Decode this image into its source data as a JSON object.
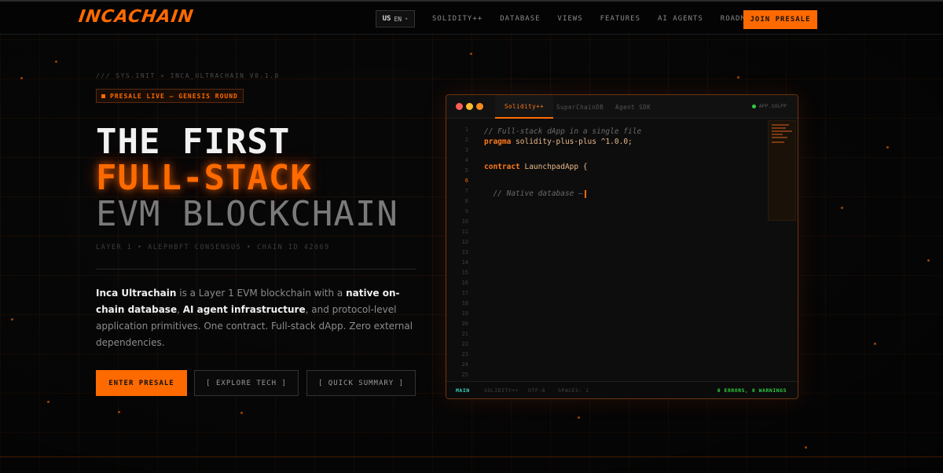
{
  "nav": {
    "logo": "INCACHAIN",
    "lang": {
      "flag": "US",
      "code": "EN",
      "chevron": "▾"
    },
    "links": [
      "SOLIDITY++",
      "DATABASE",
      "VIEWS",
      "FEATURES",
      "AI AGENTS",
      "ROADMAP"
    ],
    "cta": "JOIN PRESALE"
  },
  "hero": {
    "sysinit": "/// SYS.INIT » INCA_ULTRACHAIN V0.1.0",
    "badge": "PRESALE LIVE — GENESIS ROUND",
    "title_line1": "THE FIRST",
    "title_line2": "FULL-STACK",
    "title_line3": "EVM BLOCKCHAIN",
    "meta": "LAYER 1 • ALEPHBFT CONSENSUS • CHAIN ID 42069",
    "desc": {
      "p1": "Inca Ultrachain",
      "p2": " is a Layer 1 EVM blockchain with a ",
      "p3": "native on-chain database",
      "p4": ", ",
      "p5": "AI agent infrastructure",
      "p6": ", and protocol-level application primitives. One contract. Full-stack dApp. Zero external dependencies."
    },
    "buttons": {
      "primary": "ENTER PRESALE",
      "explore": "[ EXPLORE TECH ]",
      "summary": "[ QUICK SUMMARY ]"
    }
  },
  "editor": {
    "tabs": [
      "Solidity++",
      "SuperChainDB",
      "Agent SDK"
    ],
    "file": "APP.SOLPP",
    "line_numbers": [
      "1",
      "2",
      "3",
      "4",
      "5",
      "6",
      "7",
      "8",
      "9",
      "10",
      "11",
      "12",
      "13",
      "14",
      "15",
      "16",
      "17",
      "18",
      "19",
      "20",
      "21",
      "22",
      "23",
      "24",
      "25"
    ],
    "current_line": "6",
    "code": {
      "l1": "// Full-stack dApp in a single file",
      "l2_kw": "pragma",
      "l2_id": " solidity-plus-plus",
      "l2_ver": " ^1.0.0;",
      "l4_kw": "contract",
      "l4_id": " LaunchpadApp",
      "l4_rest": " {",
      "l7": "  // Native database —"
    },
    "statusbar": {
      "branch": "MAIN",
      "lang": "SOLIDITY++",
      "encoding": "UTF-8",
      "spaces": "SPACES: 2",
      "result": "0 ERRORS, 0 WARNINGS"
    }
  },
  "colors": {
    "accent": "#ff6a00",
    "bg": "#070707",
    "ok": "#2ecc40"
  }
}
